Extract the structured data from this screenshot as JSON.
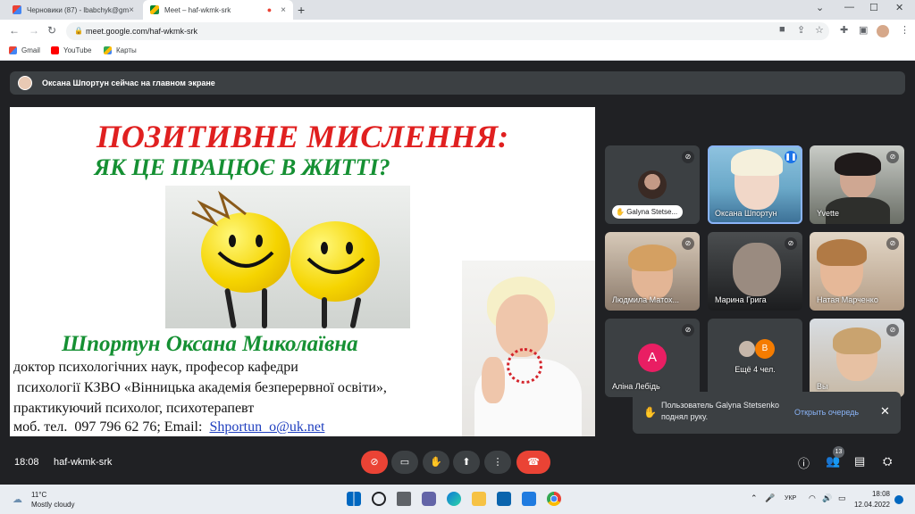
{
  "browser": {
    "tabs": [
      {
        "title": "Черновики (87) - lbabchyk@gm",
        "icon": "gmail-icon"
      },
      {
        "title": "Meet – haf-wkmk-srk",
        "icon": "meet-icon"
      }
    ],
    "url": "meet.google.com/haf-wkmk-srk",
    "bookmarks": [
      {
        "label": "Gmail",
        "icon": "gmail-icon"
      },
      {
        "label": "YouTube",
        "icon": "youtube-icon"
      },
      {
        "label": "Карты",
        "icon": "maps-icon"
      }
    ]
  },
  "meet": {
    "banner": "Оксана Шпортун сейчас на главном экране",
    "slide": {
      "title1": "ПОЗИТИВНЕ МИСЛЕННЯ:",
      "title2": "ЯК ЦЕ ПРАЦЮЄ В ЖИТТІ?",
      "name": "Шпортун Оксана Миколаївна",
      "line1": "доктор психологічних наук, професор кафедри",
      "line2": " психології КЗВО «Вінницька академія безперервної освіти»,",
      "line3": "практикуючий психолог, психотерапевт",
      "line4": "моб. тел.  097 796 62 76; Email:  ",
      "email": "Shportun_o@uk.net"
    },
    "tiles": [
      {
        "name": "Galyna Stetse...",
        "muted": true
      },
      {
        "name": "Оксана Шпортун",
        "speaking": true
      },
      {
        "name": "Yvette",
        "muted": true
      },
      {
        "name": "Людмила Матох...",
        "muted": true
      },
      {
        "name": "Марина Грига",
        "muted": true
      },
      {
        "name": "Натая Марченко",
        "muted": true
      },
      {
        "name": "Аліна Лебідь",
        "initial": "А",
        "muted": true
      },
      {
        "name": "Ещё 4 чел.",
        "initial": "В"
      },
      {
        "name": "Вы",
        "muted": true
      }
    ],
    "toast": {
      "message": "Пользователь Galyna Stetsenko поднял руку.",
      "action": "Открыть очередь"
    },
    "bottom": {
      "time": "18:08",
      "code": "haf-wkmk-srk",
      "participants_count": "13"
    },
    "colors": {
      "accent": "#8ab4f8",
      "danger": "#ea4335",
      "avatar_pink": "#e91e63",
      "avatar_orange": "#f57c00"
    }
  },
  "taskbar": {
    "temperature": "11°C",
    "weather": "Mostly cloudy",
    "lang": "УКР",
    "time": "18:08",
    "date": "12.04.2022"
  }
}
